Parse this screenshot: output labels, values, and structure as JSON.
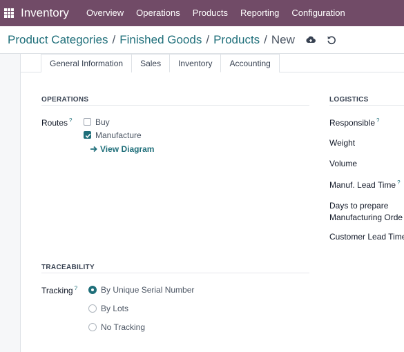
{
  "navbar": {
    "app_name": "Inventory",
    "menu": [
      "Overview",
      "Operations",
      "Products",
      "Reporting",
      "Configuration"
    ]
  },
  "breadcrumb": {
    "items": [
      "Product Categories",
      "Finished Goods",
      "Products"
    ],
    "current": "New",
    "separator": "/"
  },
  "tabs": [
    "General Information",
    "Sales",
    "Inventory",
    "Accounting"
  ],
  "active_tab": "Inventory",
  "operations": {
    "title": "OPERATIONS",
    "routes_label": "Routes",
    "help_mark": "?",
    "routes": [
      {
        "label": "Buy",
        "checked": false
      },
      {
        "label": "Manufacture",
        "checked": true
      }
    ],
    "view_diagram": "View Diagram"
  },
  "logistics": {
    "title": "LOGISTICS",
    "fields": [
      "Responsible",
      "Weight",
      "Volume",
      "Manuf. Lead Time",
      "Days to prepare",
      "Manufacturing Orde",
      "Customer Lead Time"
    ]
  },
  "traceability": {
    "title": "TRACEABILITY",
    "tracking_label": "Tracking",
    "options": [
      {
        "label": "By Unique Serial Number",
        "selected": true
      },
      {
        "label": "By Lots",
        "selected": false
      },
      {
        "label": "No Tracking",
        "selected": false
      }
    ]
  },
  "colors": {
    "navbar": "#714b67",
    "accent": "#1f6f7a"
  }
}
